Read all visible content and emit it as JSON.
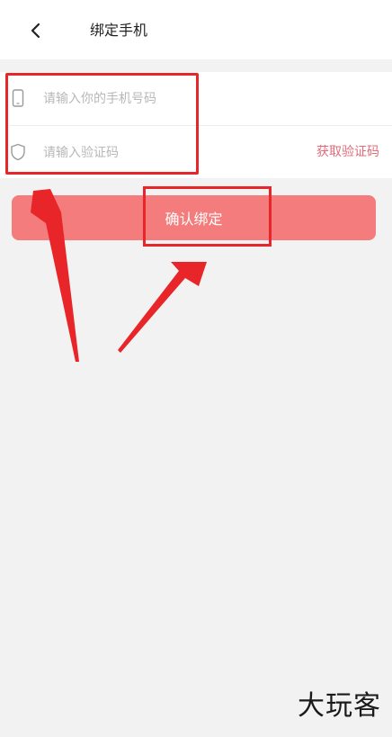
{
  "header": {
    "title": "绑定手机",
    "back_icon": "chevron-left-icon"
  },
  "form": {
    "phone": {
      "icon": "phone-icon",
      "placeholder": "请输入你的手机号码",
      "value": ""
    },
    "code": {
      "icon": "shield-icon",
      "placeholder": "请输入验证码",
      "value": "",
      "get_code_label": "获取验证码"
    }
  },
  "confirm": {
    "label": "确认绑定"
  },
  "watermark": "大玩客",
  "colors": {
    "accent": "#f47c7c",
    "link": "#e26a7a",
    "annotation": "#e8262a",
    "background": "#f2f2f2"
  }
}
